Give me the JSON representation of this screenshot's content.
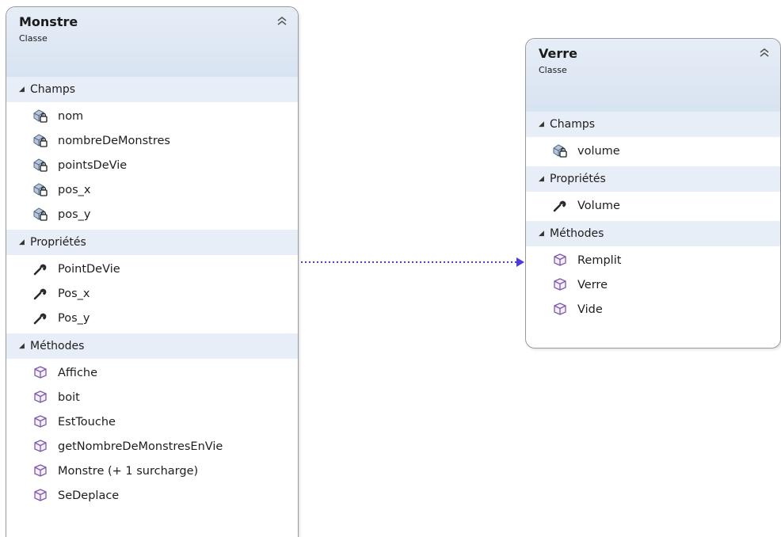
{
  "classes": [
    {
      "name": "Monstre",
      "kind": "Classe",
      "sections": [
        {
          "title": "Champs",
          "type": "field",
          "items": [
            "nom",
            "nombreDeMonstres",
            "pointsDeVie",
            "pos_x",
            "pos_y"
          ]
        },
        {
          "title": "Propriétés",
          "type": "property",
          "items": [
            "PointDeVie",
            "Pos_x",
            "Pos_y"
          ]
        },
        {
          "title": "Méthodes",
          "type": "method",
          "items": [
            "Affiche",
            "boit",
            "EstTouche",
            "getNombreDeMonstresEnVie",
            "Monstre (+ 1 surcharge)",
            "SeDeplace"
          ]
        }
      ]
    },
    {
      "name": "Verre",
      "kind": "Classe",
      "sections": [
        {
          "title": "Champs",
          "type": "field",
          "items": [
            "volume"
          ]
        },
        {
          "title": "Propriétés",
          "type": "property",
          "items": [
            "Volume"
          ]
        },
        {
          "title": "Méthodes",
          "type": "method",
          "items": [
            "Remplit",
            "Verre",
            "Vide"
          ]
        }
      ]
    }
  ],
  "relationship": {
    "from": "Monstre",
    "to": "Verre",
    "style": "dotted",
    "color": "#4b3bd8"
  },
  "colors": {
    "header_bg": "#dfe7f3",
    "section_bg": "#e8eef7",
    "border": "#9a9a9a",
    "method_icon": "#7e5aa6"
  }
}
